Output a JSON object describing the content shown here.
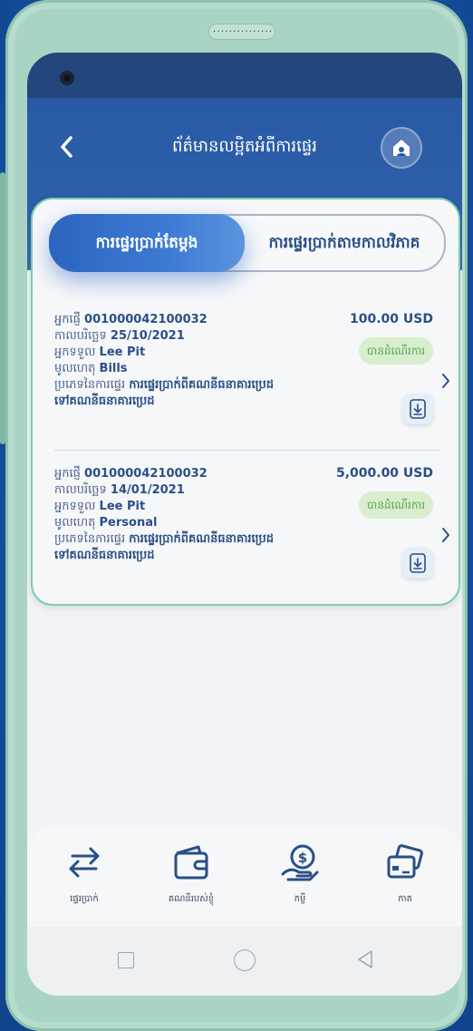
{
  "speaker_dots": "...............",
  "header": {
    "title": "ព័ត៌មានលម្អិតអំពីការផ្ទេរ"
  },
  "tabs": {
    "active": "ការផ្ទេរប្រាក់តែម្តង",
    "inactive": "ការផ្ទេរប្រាក់តាមកាលវិភាគ"
  },
  "labels": {
    "sender": "អ្នកផ្ញើ",
    "date": "កាលបរិច្ឆេទ",
    "receiver": "អ្នកទទួល",
    "reason": "មូលហេតុ",
    "type": "ប្រភេទនៃការផ្ទេរ"
  },
  "transactions": [
    {
      "sender": "001000042100032",
      "date": "25/10/2021",
      "receiver": "Lee Pit",
      "reason": "Bills",
      "type_line1": "ការផ្ទេរប្រាក់ពីគណនីធនាគារប្រេដ",
      "type_line2": "ទៅគណនីធនាគារប្រេដ",
      "amount": "100.00 USD",
      "status": "បានដំណើរការ"
    },
    {
      "sender": "001000042100032",
      "date": "14/01/2021",
      "receiver": "Lee Pit",
      "reason": "Personal",
      "type_line1": "ការផ្ទេរប្រាក់ពីគណនីធនាគារប្រេដ",
      "type_line2": "ទៅគណនីធនាគារប្រេដ",
      "amount": "5,000.00 USD",
      "status": "បានដំណើរការ"
    }
  ],
  "bottom_nav": {
    "items": [
      {
        "label": "ផ្ទេរប្រាក់",
        "icon": "transfer-arrows-icon"
      },
      {
        "label": "គណនីរបស់ខ្ញុំ",
        "icon": "wallet-icon"
      },
      {
        "label": "កម្ចី",
        "icon": "loan-coin-hand-icon"
      },
      {
        "label": "កាត",
        "icon": "cards-icon"
      }
    ]
  },
  "colors": {
    "primary": "#2a5aa6",
    "text": "#2a4f86",
    "status_bg": "#d8eecf",
    "status_text": "#59a54f",
    "card_border": "#7ccdb1"
  }
}
